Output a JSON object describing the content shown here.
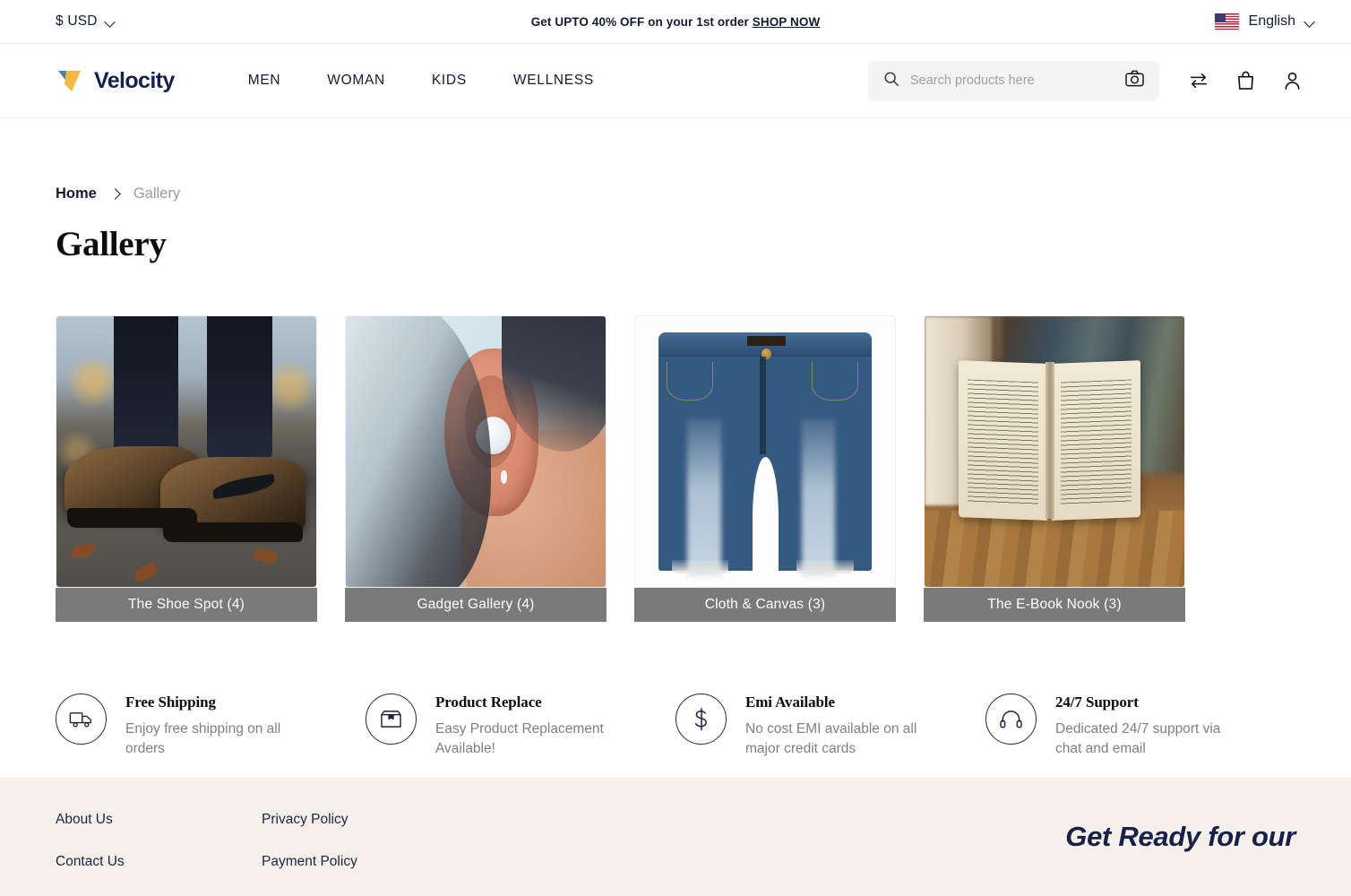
{
  "topbar": {
    "currency": "$ USD",
    "currency_icon": "chevron-down-icon",
    "promo_text": "Get UPTO 40% OFF on your 1st order",
    "promo_link": "SHOP NOW",
    "language": "English",
    "flag_icon": "us-flag-icon"
  },
  "header": {
    "brand": "Velocity",
    "logo_icon": "velocity-check-logo",
    "logo_colors": {
      "blue": "#4a7fb5",
      "yellow": "#f5b942",
      "text": "#16204d"
    },
    "nav": [
      {
        "label": "MEN"
      },
      {
        "label": "WOMAN"
      },
      {
        "label": "KIDS"
      },
      {
        "label": "WELLNESS"
      }
    ],
    "search": {
      "placeholder": "Search products here",
      "value": ""
    },
    "icons": [
      {
        "name": "compare-icon"
      },
      {
        "name": "shopping-bag-icon"
      },
      {
        "name": "user-account-icon"
      }
    ]
  },
  "breadcrumb": {
    "home": "Home",
    "current": "Gallery"
  },
  "page_title": "Gallery",
  "gallery": {
    "items": [
      {
        "label": "The Shoe Spot (4)",
        "image_alt": "brown leather sneakers on autumn leaves"
      },
      {
        "label": "Gadget Gallery (4)",
        "image_alt": "white wireless earbud in ear"
      },
      {
        "label": "Cloth & Canvas (3)",
        "image_alt": "blue denim shorts on white background"
      },
      {
        "label": "The E-Book Nook (3)",
        "image_alt": "open book on wooden table by bookshelf"
      }
    ],
    "caption_bg": "#7a7a7a"
  },
  "features": [
    {
      "icon": "delivery-truck-icon",
      "title": "Free Shipping",
      "desc": "Enjoy free shipping on all orders"
    },
    {
      "icon": "package-box-icon",
      "title": "Product Replace",
      "desc": "Easy Product Replacement Available!"
    },
    {
      "icon": "dollar-sign-icon",
      "title": "Emi Available",
      "desc": "No cost EMI available on all major credit cards"
    },
    {
      "icon": "headset-icon",
      "title": "24/7 Support",
      "desc": "Dedicated 24/7 support via chat and email"
    }
  ],
  "footer": {
    "background": "#f5f0e9",
    "col1": [
      {
        "label": "About Us"
      },
      {
        "label": "Contact Us"
      }
    ],
    "col2": [
      {
        "label": "Privacy Policy"
      },
      {
        "label": "Payment Policy"
      }
    ],
    "newsletter_title": "Get Ready for our"
  }
}
